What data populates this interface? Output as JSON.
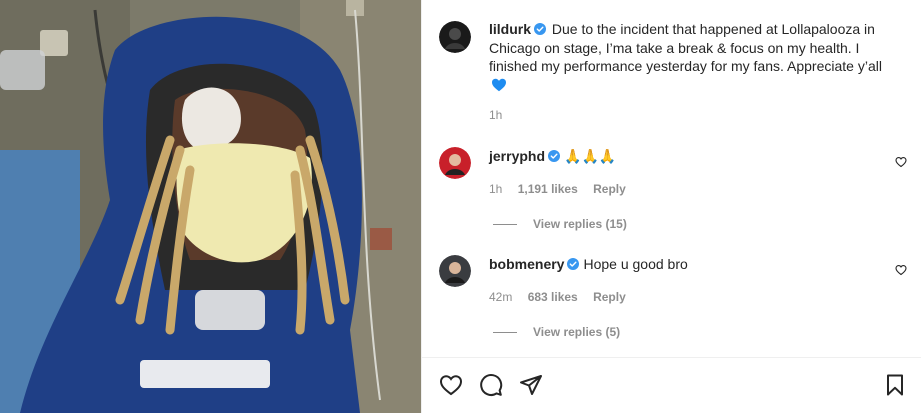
{
  "post": {
    "author": "lildurk",
    "caption": "Due to the incident that happened at Lollapalooza in Chicago on stage, I’ma take a break & focus on my health. I finished my performance yesterday for my fans. Appreciate y’all",
    "caption_emoji": "blue-heart-icon",
    "time": "1h",
    "verified": true
  },
  "comments": [
    {
      "username": "jerryphd",
      "text": "🙏🙏🙏",
      "time": "1h",
      "likes": "1,191 likes",
      "reply_label": "Reply",
      "view_replies": "View replies (15)",
      "verified": true
    },
    {
      "username": "bobmenery",
      "text": "Hope u good bro",
      "time": "42m",
      "likes": "683 likes",
      "reply_label": "Reply",
      "view_replies": "View replies (5)",
      "verified": true
    }
  ],
  "actions": [
    "heart-icon",
    "comment-icon",
    "share-icon",
    "bookmark-icon"
  ],
  "colors": {
    "verified_blue": "#3897f0",
    "heart_blue": "#1e8cf0",
    "secondary_text": "#8e8e8e",
    "primary_text": "#262626"
  }
}
